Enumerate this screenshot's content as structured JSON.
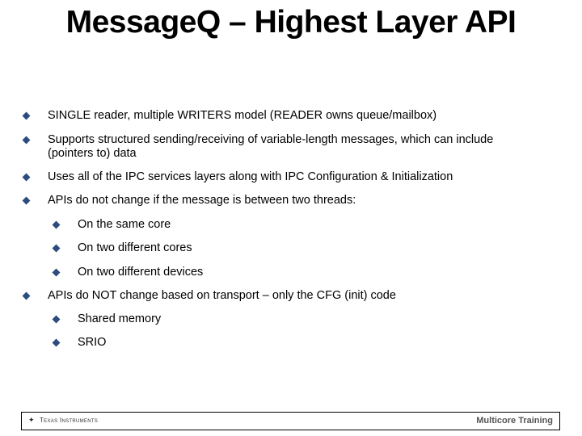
{
  "slide": {
    "title": "MessageQ – Highest Layer API",
    "bullets": [
      {
        "level": 1,
        "text": "SINGLE reader, multiple WRITERS model (READER owns queue/mailbox)"
      },
      {
        "level": 1,
        "text": "Supports structured sending/receiving of variable-length messages, which can include (pointers to) data"
      },
      {
        "level": 1,
        "text": "Uses all of the IPC services layers along with IPC Configuration & Initialization"
      },
      {
        "level": 1,
        "text": "APIs do not change if the message is between two threads:"
      },
      {
        "level": 2,
        "text": "On the same core"
      },
      {
        "level": 2,
        "text": "On two different cores"
      },
      {
        "level": 2,
        "text": "On two different devices"
      },
      {
        "level": 1,
        "text": "APIs do NOT change based on transport – only the CFG (init) code"
      },
      {
        "level": 2,
        "text": "Shared memory"
      },
      {
        "level": 2,
        "text": "SRIO"
      }
    ],
    "bullet_icon": "diamond-bullet-icon",
    "bullet_color": "#2c4b7e"
  },
  "footer": {
    "logo_icon": "texas-instruments-logo-icon",
    "logo_text": "Texas Instruments",
    "right_text": "Multicore Training"
  }
}
